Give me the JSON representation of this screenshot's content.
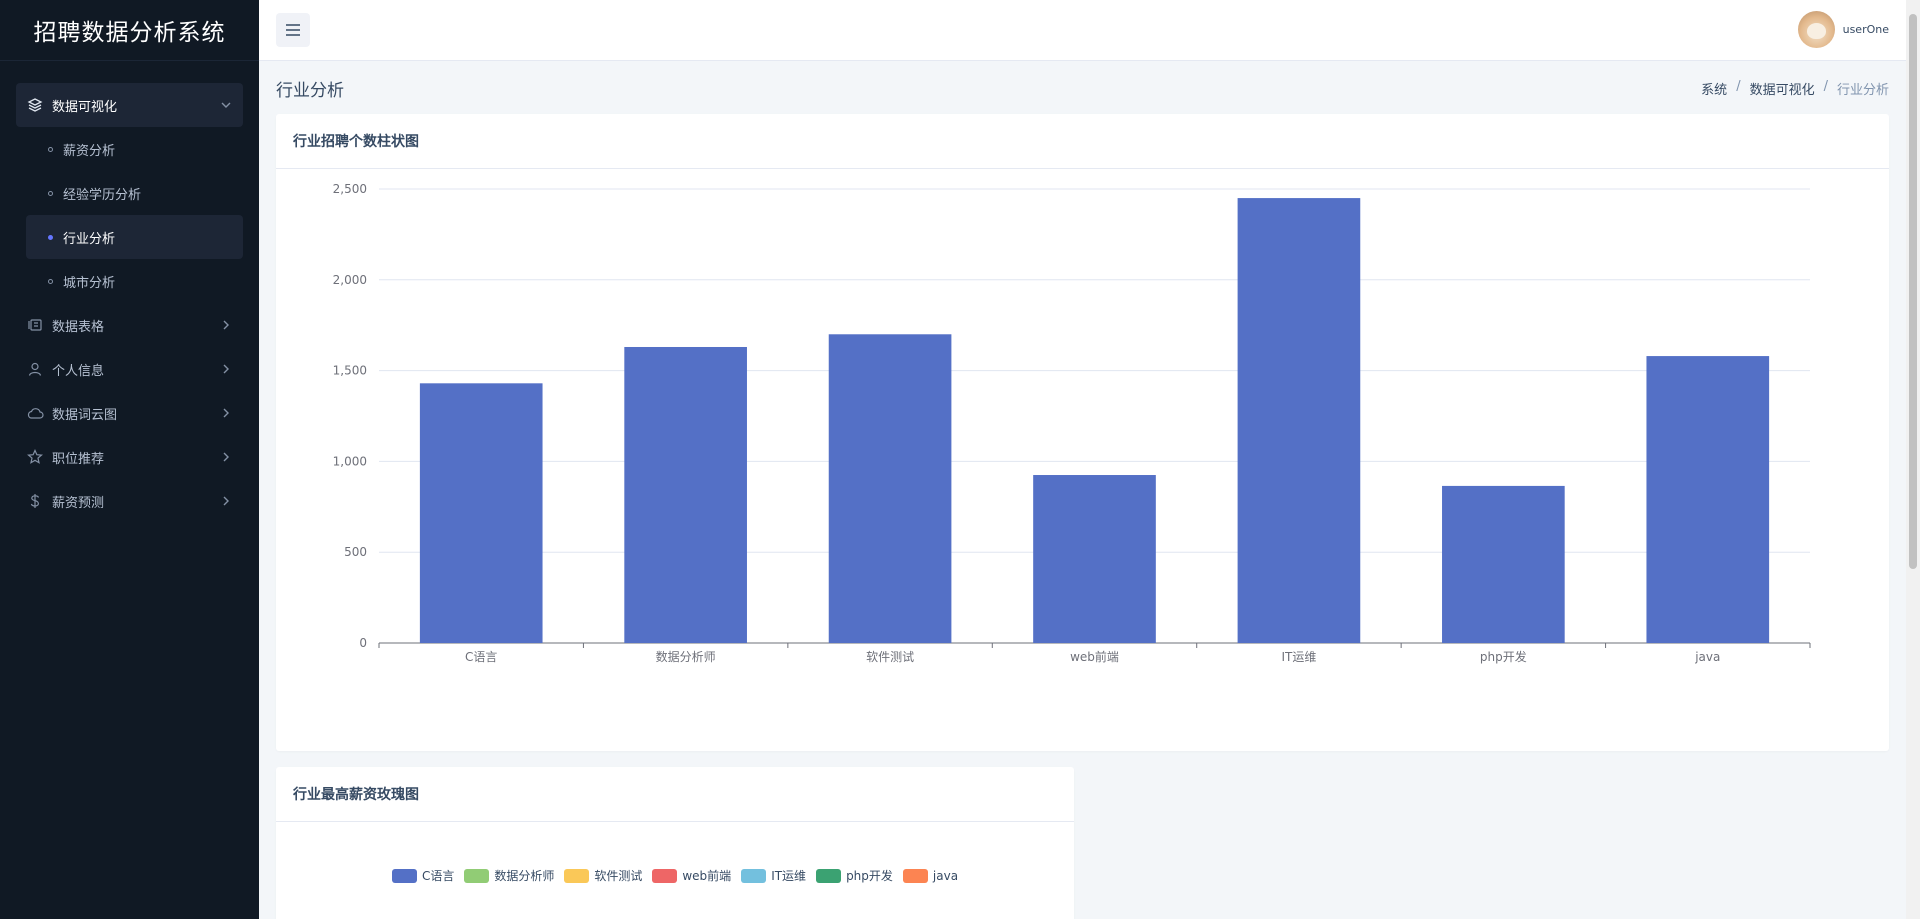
{
  "app": {
    "title": "招聘数据分析系统"
  },
  "sidebar": {
    "group": {
      "label": "数据可视化"
    },
    "sub_items": [
      {
        "label": "薪资分析",
        "active": false
      },
      {
        "label": "经验学历分析",
        "active": false
      },
      {
        "label": "行业分析",
        "active": true
      },
      {
        "label": "城市分析",
        "active": false
      }
    ],
    "items": [
      {
        "label": "数据表格",
        "icon": "table-icon"
      },
      {
        "label": "个人信息",
        "icon": "user-icon"
      },
      {
        "label": "数据词云图",
        "icon": "cloud-icon"
      },
      {
        "label": "职位推荐",
        "icon": "star-icon"
      },
      {
        "label": "薪资预测",
        "icon": "dollar-icon"
      }
    ]
  },
  "header": {
    "username": "userOne"
  },
  "page": {
    "title": "行业分析",
    "breadcrumb": [
      "系统",
      "数据可视化",
      "行业分析"
    ]
  },
  "cards": {
    "bar_title": "行业招聘个数柱状图",
    "rose_title": "行业最高薪资玫瑰图"
  },
  "colors": {
    "bar": "#5470c6",
    "legend": [
      "#5470c6",
      "#91cc75",
      "#fac858",
      "#ee6666",
      "#73c0de",
      "#3ba272",
      "#fc8452"
    ]
  },
  "chart_data": [
    {
      "type": "bar",
      "title": "行业招聘个数柱状图",
      "categories": [
        "C语言",
        "数据分析师",
        "软件测试",
        "web前端",
        "IT运维",
        "php开发",
        "java"
      ],
      "values": [
        1430,
        1630,
        1700,
        925,
        2450,
        865,
        1580
      ],
      "ylim": [
        0,
        2500
      ],
      "yticks": [
        "0",
        "500",
        "1,000",
        "1,500",
        "2,000",
        "2,500"
      ],
      "ytick_values": [
        0,
        500,
        1000,
        1500,
        2000,
        2500
      ],
      "grid": true
    },
    {
      "type": "pie",
      "title": "行业最高薪资玫瑰图",
      "legend": [
        "C语言",
        "数据分析师",
        "软件测试",
        "web前端",
        "IT运维",
        "php开发",
        "java"
      ],
      "legend_position": "top"
    }
  ]
}
